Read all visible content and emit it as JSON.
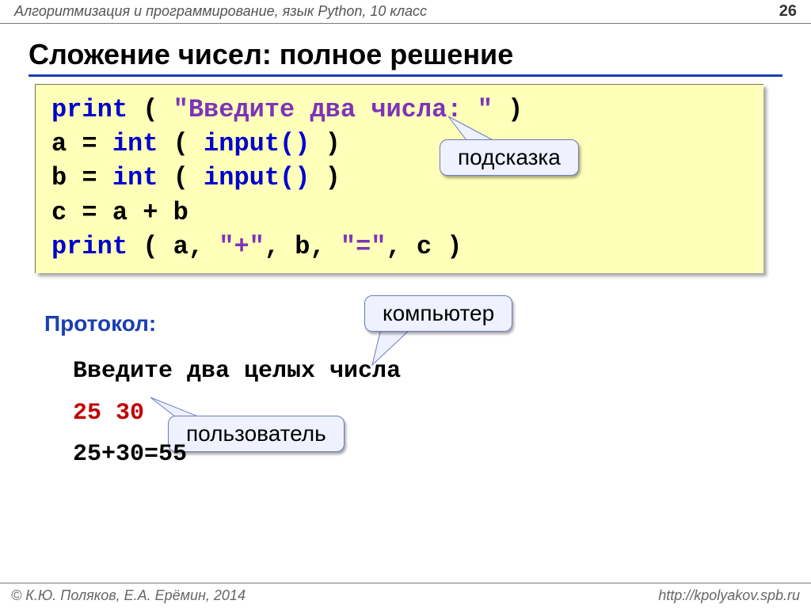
{
  "header": {
    "breadcrumb": "Алгоритмизация и программирование, язык Python, 10 класс",
    "page_number": "26"
  },
  "title": "Сложение чисел: полное решение",
  "code": {
    "kw_print": "print",
    "kw_int": "int",
    "kw_input": "input()",
    "str_prompt": "\"Введите два числа: \"",
    "line2_left": "a = ",
    "line3_left": "b = ",
    "paren_open": " ( ",
    "paren_close": " )",
    "line4": "c = a + b",
    "line5_args_pre": " ( a, ",
    "str_plus": "\"+\"",
    "line5_mid": ", b, ",
    "str_eq": "\"=\"",
    "line5_end": ", c )"
  },
  "callouts": {
    "hint": "подсказка",
    "computer": "компьютер",
    "user": "пользователь"
  },
  "protocol": {
    "label": "Протокол:",
    "line1": "Введите два целых числа",
    "line2_user": "25 30",
    "line3": "25+30=55"
  },
  "footer": {
    "left": "© К.Ю. Поляков, Е.А. Ерёмин, 2014",
    "right": "http://kpolyakov.spb.ru"
  }
}
